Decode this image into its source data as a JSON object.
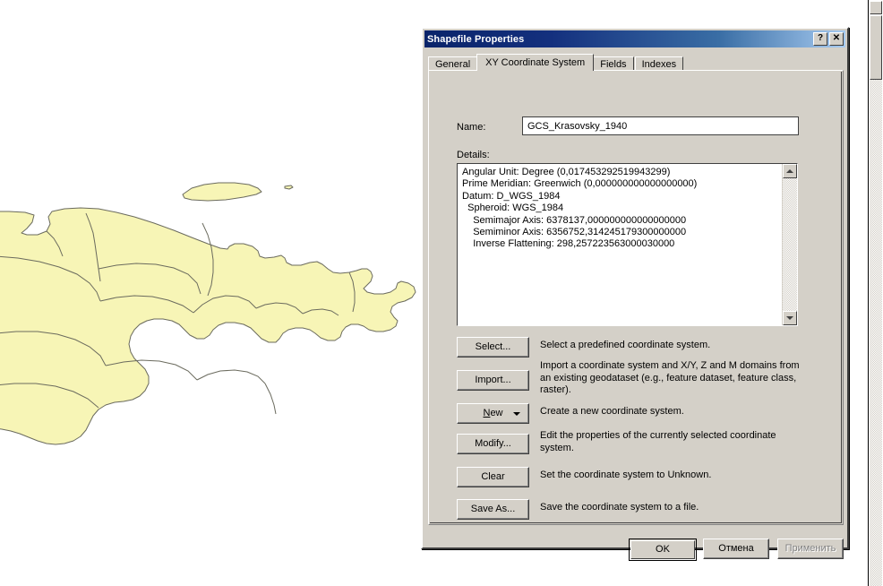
{
  "window": {
    "title": "Shapefile Properties",
    "help_button": "?",
    "close_button": "✕"
  },
  "tabs": [
    {
      "label": "General",
      "active": false
    },
    {
      "label": "XY Coordinate System",
      "active": true
    },
    {
      "label": "Fields",
      "active": false
    },
    {
      "label": "Indexes",
      "active": false
    }
  ],
  "form": {
    "name_label": "Name:",
    "name_value": "GCS_Krasovsky_1940",
    "details_label": "Details:",
    "details_text": "Angular Unit: Degree (0,017453292519943299)\nPrime Meridian: Greenwich (0,000000000000000000)\nDatum: D_WGS_1984\n  Spheroid: WGS_1984\n    Semimajor Axis: 6378137,000000000000000000\n    Semiminor Axis: 6356752,314245179300000000\n    Inverse Flattening: 298,257223563000030000"
  },
  "actions": [
    {
      "label": "Select...",
      "description": "Select a predefined coordinate system.",
      "has_dropdown": false,
      "accel": ""
    },
    {
      "label": "Import...",
      "description": "Import a coordinate system and X/Y, Z and M domains from an existing geodataset (e.g., feature dataset, feature class, raster).",
      "has_dropdown": false,
      "accel": ""
    },
    {
      "label": "New",
      "description": "Create a new coordinate system.",
      "has_dropdown": true,
      "accel": "N"
    },
    {
      "label": "Modify...",
      "description": "Edit the properties of the currently selected coordinate system.",
      "has_dropdown": false,
      "accel": ""
    },
    {
      "label": "Clear",
      "description": "Set the coordinate system to Unknown.",
      "has_dropdown": false,
      "accel": ""
    },
    {
      "label": "Save As...",
      "description": "Save the coordinate system to a file.",
      "has_dropdown": false,
      "accel": ""
    }
  ],
  "footer": {
    "ok_label": "OK",
    "cancel_label": "Отмена",
    "apply_label": "Применить",
    "apply_disabled": true
  },
  "map": {
    "polygon_fill": "#f7f5b6",
    "polygon_stroke": "#6b6b5e",
    "background": "#ffffff"
  },
  "colors": {
    "dialog_face": "#d4d0c8",
    "titlebar_start": "#0a246a",
    "titlebar_end": "#a6caf0",
    "field_background": "#ffffff"
  }
}
